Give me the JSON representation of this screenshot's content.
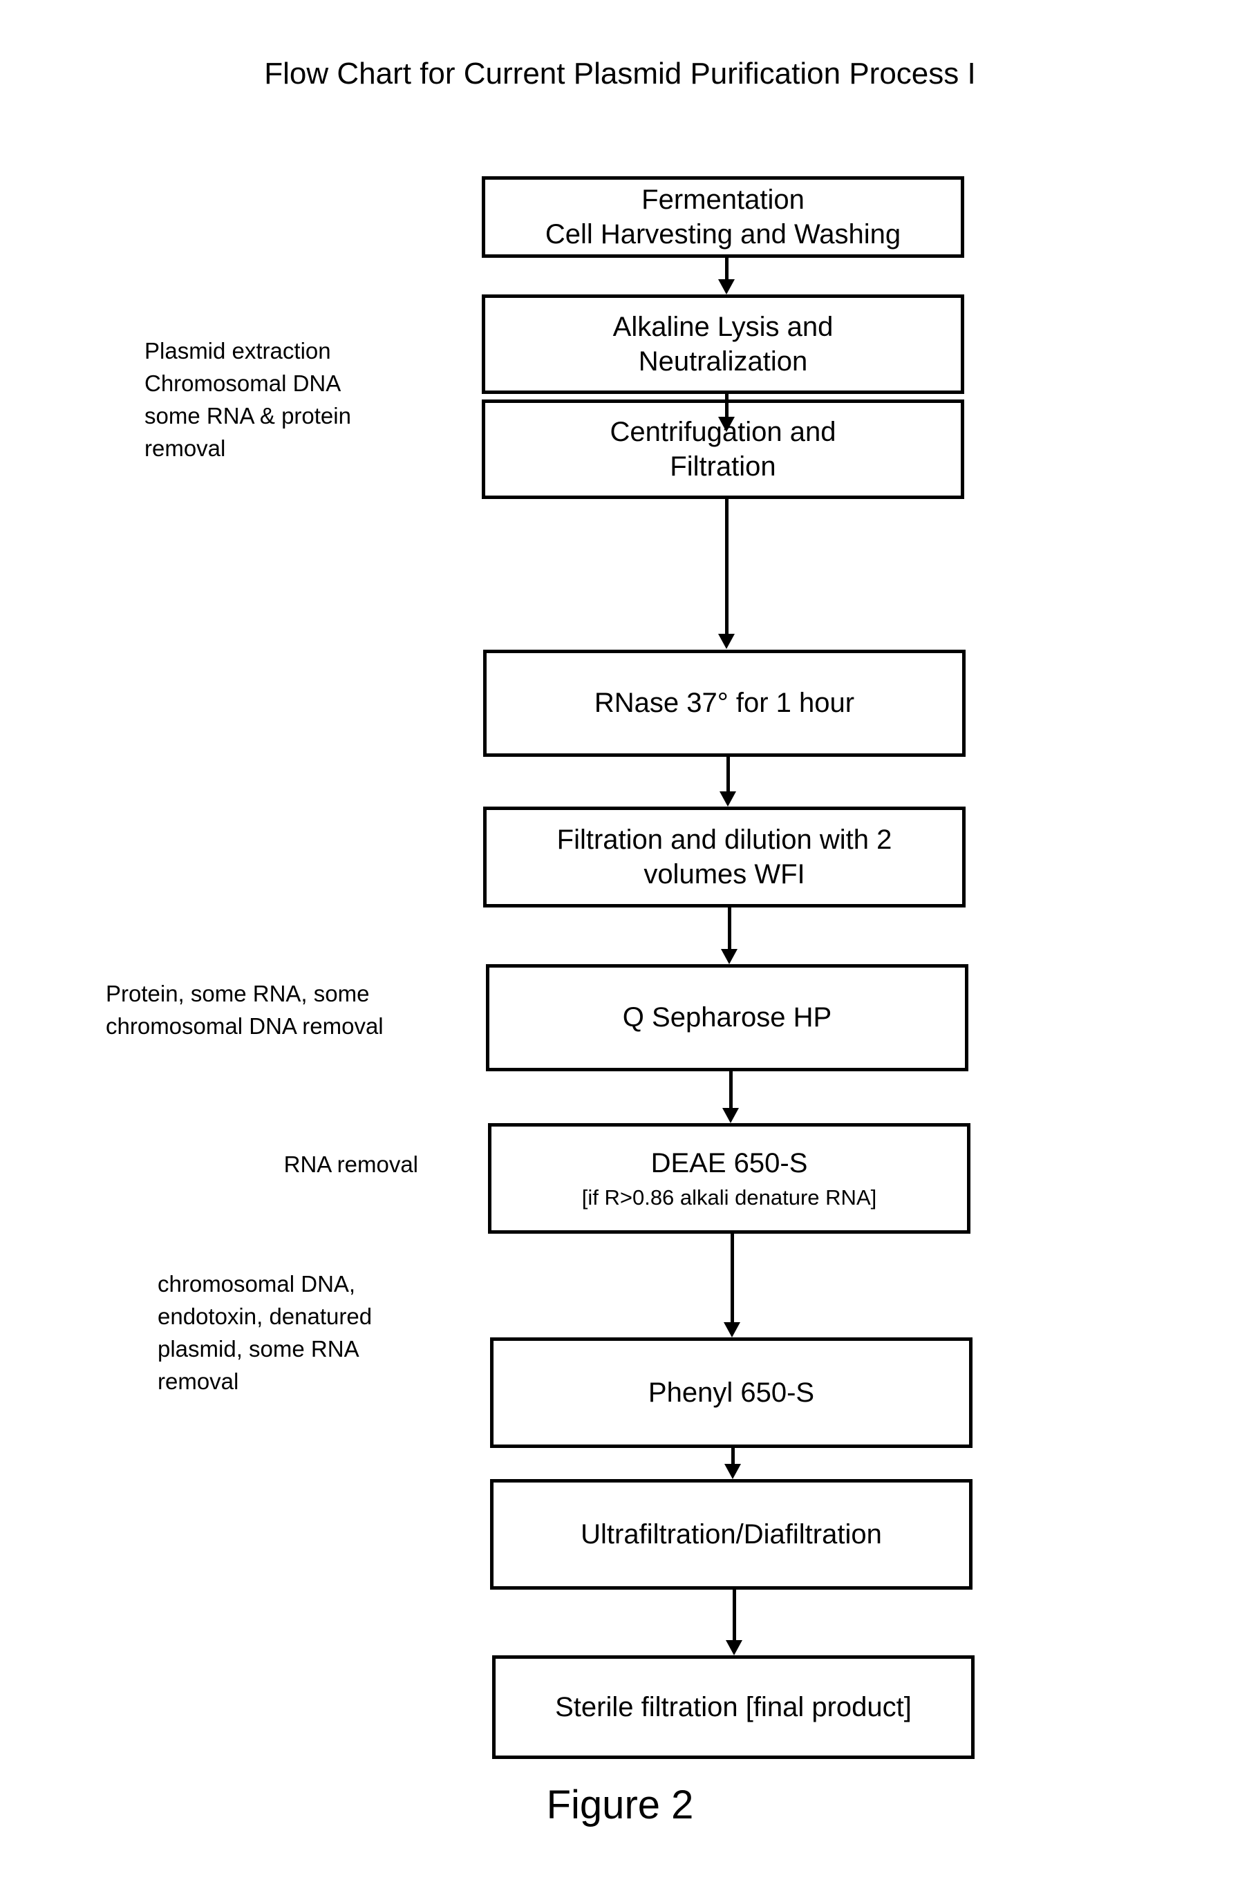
{
  "title": "Flow Chart for Current Plasmid Purification Process I",
  "caption": "Figure 2",
  "colors": {
    "background": "#ffffff",
    "stroke": "#000000",
    "text": "#000000"
  },
  "flow": {
    "boxes": [
      {
        "id": "fermentation",
        "line1": "Fermentation",
        "line2": "Cell Harvesting and Washing"
      },
      {
        "id": "alkaline-lysis",
        "line1": "Alkaline Lysis and",
        "line2": "Neutralization"
      },
      {
        "id": "centrifugation",
        "line1": "Centrifugation and",
        "line2": "Filtration"
      },
      {
        "id": "rnase",
        "line1": "RNase 37° for 1 hour",
        "line2": ""
      },
      {
        "id": "filtration-dilution",
        "line1": "Filtration and dilution with 2",
        "line2": "volumes WFI"
      },
      {
        "id": "q-sepharose",
        "line1": "Q Sepharose HP",
        "line2": ""
      },
      {
        "id": "deae",
        "line1": "DEAE 650-S",
        "sub": "[if R>0.86 alkali denature RNA]"
      },
      {
        "id": "phenyl",
        "line1": "Phenyl 650-S",
        "line2": ""
      },
      {
        "id": "ultrafiltration",
        "line1": "Ultrafiltration/Diafiltration",
        "line2": ""
      },
      {
        "id": "sterile-filtration",
        "line1": "Sterile filtration [final product]",
        "line2": ""
      }
    ],
    "arrow_count": 9
  },
  "annotations": [
    {
      "id": "plasmid-extraction",
      "text": "Plasmid extraction\nChromosomal DNA\nsome RNA & protein\nremoval"
    },
    {
      "id": "protein-rna-removal",
      "text": "Protein, some RNA, some\nchromosomal DNA removal"
    },
    {
      "id": "rna-removal",
      "text": "RNA removal"
    },
    {
      "id": "chromosomal-dna-removal",
      "text": "chromosomal DNA,\nendotoxin, denatured\nplasmid, some RNA\nremoval"
    }
  ],
  "chart_data": {
    "type": "diagram",
    "diagram_type": "flowchart",
    "orientation": "top-to-bottom",
    "title": "Flow Chart for Current Plasmid Purification Process I",
    "nodes": [
      "Fermentation Cell Harvesting and Washing",
      "Alkaline Lysis and Neutralization",
      "Centrifugation and Filtration",
      "RNase 37° for 1 hour",
      "Filtration and dilution with 2 volumes WFI",
      "Q Sepharose HP",
      "DEAE 650-S [if R>0.86 alkali denature RNA]",
      "Phenyl 650-S",
      "Ultrafiltration/Diafiltration",
      "Sterile filtration [final product]"
    ],
    "edges": [
      [
        0,
        1
      ],
      [
        1,
        2
      ],
      [
        2,
        3
      ],
      [
        3,
        4
      ],
      [
        4,
        5
      ],
      [
        5,
        6
      ],
      [
        6,
        7
      ],
      [
        7,
        8
      ],
      [
        8,
        9
      ]
    ],
    "side_notes": [
      {
        "attached_to": "Alkaline Lysis and Neutralization",
        "text": "Plasmid extraction Chromosomal DNA some RNA & protein removal"
      },
      {
        "attached_to": "Q Sepharose HP",
        "text": "Protein, some RNA, some chromosomal DNA removal"
      },
      {
        "attached_to": "DEAE 650-S",
        "text": "RNA removal"
      },
      {
        "attached_to": "Phenyl 650-S",
        "text": "chromosomal DNA, endotoxin, denatured plasmid, some RNA removal"
      }
    ]
  }
}
